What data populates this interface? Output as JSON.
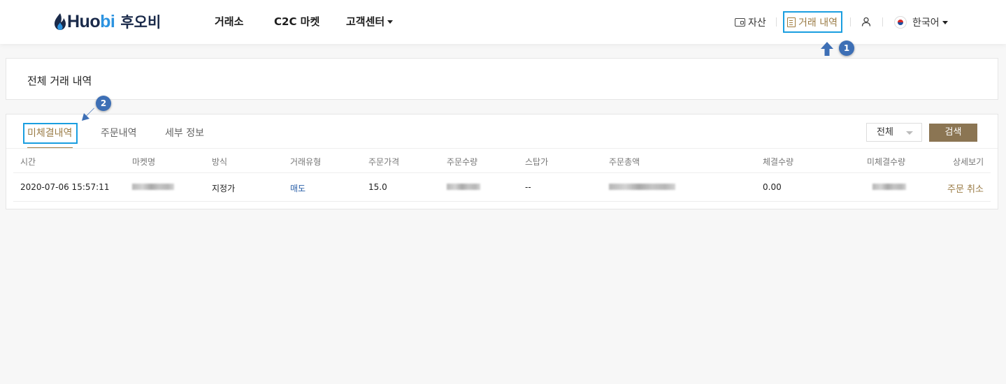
{
  "header": {
    "logo_word_a": "Huo",
    "logo_word_b": "bi",
    "logo_korean": "후오비",
    "nav": [
      {
        "label": "거래소"
      },
      {
        "label": "C2C 마켓"
      },
      {
        "label": "고객센터"
      }
    ],
    "assets_label": "자산",
    "history_label": "거래 내역",
    "language_label": "한국어"
  },
  "badges": {
    "one": "1",
    "two": "2"
  },
  "title_panel": {
    "title": "전체 거래 내역"
  },
  "orders": {
    "tabs": [
      {
        "label": "미체결내역",
        "active": true
      },
      {
        "label": "주문내역",
        "active": false
      },
      {
        "label": "세부 정보",
        "active": false
      }
    ],
    "filter": {
      "selected": "전체"
    },
    "search_label": "검색",
    "columns": [
      "시간",
      "마켓명",
      "방식",
      "거래유형",
      "주문가격",
      "주문수량",
      "스탑가",
      "주문총액",
      "체결수량",
      "미체결수량",
      "상세보기"
    ],
    "rows": [
      {
        "time": "2020-07-06 15:57:11",
        "market": "",
        "method": "지정가",
        "trade_type": "매도",
        "price": "15.0",
        "quantity": "",
        "stop_price": "--",
        "total": "",
        "filled": "0.00",
        "unfilled": "",
        "action": "주문 취소"
      }
    ]
  },
  "colors": {
    "accent_gold": "#9a7b45",
    "search_button": "#8b7553",
    "highlight_box": "#1a9ee0",
    "badge": "#3d6fb5",
    "sell_blue": "#2a5fa8"
  }
}
